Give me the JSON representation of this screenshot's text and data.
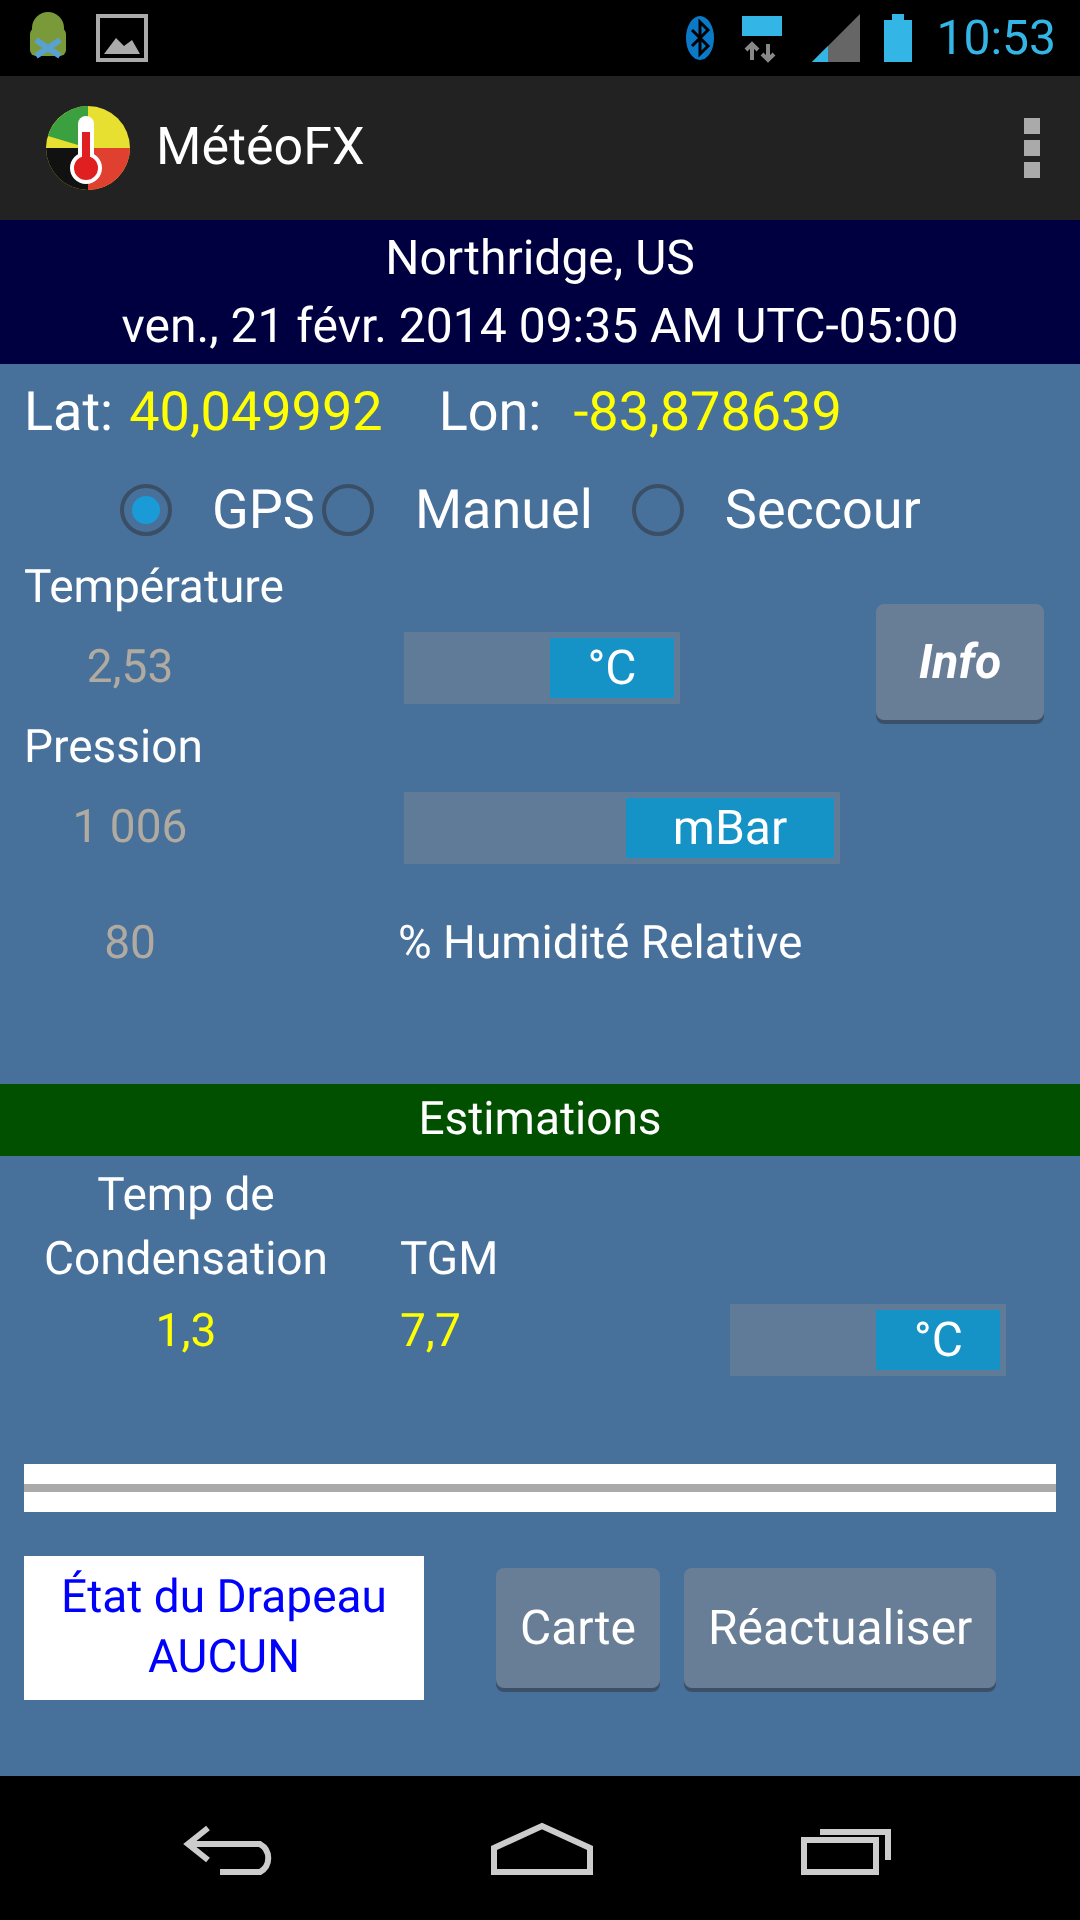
{
  "status_bar": {
    "time": "10:53"
  },
  "app_bar": {
    "title": "MétéoFX"
  },
  "location": {
    "place": "Northridge, US",
    "datetime": "ven., 21 févr. 2014 09:35 AM UTC-05:00"
  },
  "coords": {
    "lat_label": "Lat:",
    "lat": "40,049992",
    "lon_label": "Lon:",
    "lon": "-83,878639"
  },
  "source_options": [
    {
      "label": "GPS",
      "selected": true
    },
    {
      "label": "Manuel",
      "selected": false
    },
    {
      "label": "Seccour",
      "selected": false
    }
  ],
  "temperature": {
    "label": "Température",
    "value": "2,53",
    "unit_switch": {
      "label": "°C",
      "on": true
    }
  },
  "info_button": "Info",
  "pressure": {
    "label": "Pression",
    "value": "1 006",
    "unit_switch": {
      "label": "mBar",
      "on": true
    }
  },
  "humidity": {
    "value": "80",
    "label": "% Humidité Relative"
  },
  "estimations": {
    "title": "Estimations",
    "dew_label_1": "Temp de",
    "dew_label_2": "Condensation",
    "dew_value": "1,3",
    "tgm_label": "TGM",
    "tgm_value": "7,7",
    "unit_switch": {
      "label": "°C",
      "on": true
    }
  },
  "flag": {
    "line_1": "État du Drapeau",
    "line_2": "AUCUN"
  },
  "buttons": [
    "Carte",
    "Réactualiser"
  ]
}
